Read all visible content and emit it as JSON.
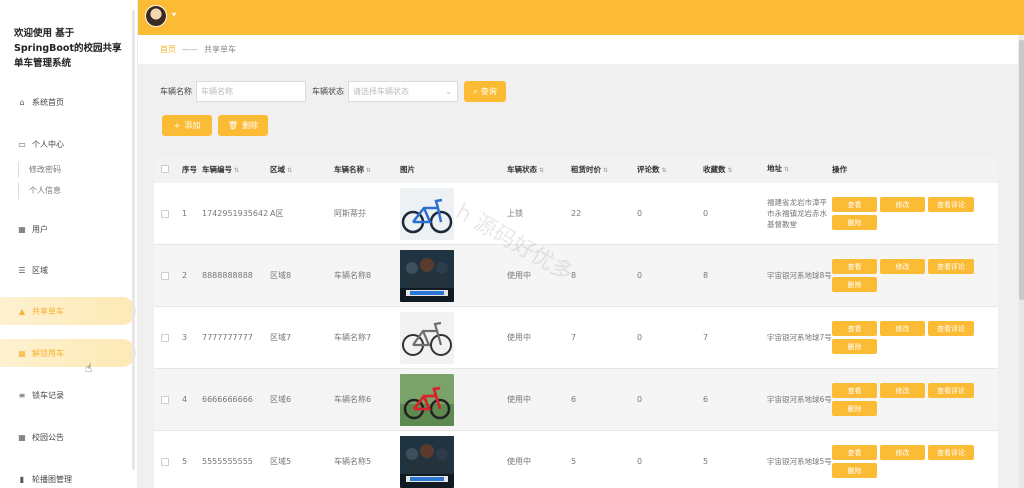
{
  "app": {
    "title": "欢迎使用 基于SpringBoot的校园共享单车管理系统"
  },
  "sidebar": {
    "items": [
      {
        "label": "系统首页",
        "icon": "home-icon"
      },
      {
        "label": "个人中心",
        "icon": "user-card-icon"
      },
      {
        "label": "用户",
        "icon": "grid-icon"
      },
      {
        "label": "区域",
        "icon": "sliders-icon"
      },
      {
        "label": "共享单车",
        "icon": "thumb-icon",
        "active": true
      },
      {
        "label": "解锁用车",
        "icon": "grid-icon",
        "hover": true
      },
      {
        "label": "锁车记录",
        "icon": "list-icon"
      },
      {
        "label": "校园公告",
        "icon": "grid-icon"
      },
      {
        "label": "轮播图管理",
        "icon": "bar-icon"
      }
    ],
    "subitems": [
      "修改密码",
      "个人信息"
    ]
  },
  "breadcrumb": {
    "home": "首页",
    "separator": "——",
    "current": "共享单车"
  },
  "search": {
    "name_label": "车辆名称",
    "name_placeholder": "车辆名称",
    "status_label": "车辆状态",
    "status_placeholder": "请选择车辆状态",
    "query_button": "查询"
  },
  "toolbar": {
    "add_label": "添加",
    "delete_label": "删除"
  },
  "table": {
    "headers": {
      "no": "序号",
      "code": "车辆编号",
      "area": "区域",
      "name": "车辆名称",
      "image": "图片",
      "status": "车辆状态",
      "price": "租赁时价",
      "comments": "评论数",
      "favorites": "收藏数",
      "address": "地址",
      "ops": "操作"
    },
    "op_labels": {
      "view": "查看",
      "edit": "修改",
      "review": "查看评论",
      "delete": "删除"
    },
    "rows": [
      {
        "no": "1",
        "code": "1742951935642",
        "area": "A区",
        "name": "阿斯蒂芬",
        "image": "blue-bike",
        "status": "上锁",
        "price": "22",
        "comments": "0",
        "favorites": "0",
        "address": "福建省龙岩市漳平市永福镇龙岩赤水基督教堂"
      },
      {
        "no": "2",
        "code": "8888888888",
        "area": "区域8",
        "name": "车辆名称8",
        "image": "movie-poster",
        "status": "使用中",
        "price": "8",
        "comments": "0",
        "favorites": "8",
        "address": "宇宙银河系地球8号"
      },
      {
        "no": "3",
        "code": "7777777777",
        "area": "区域7",
        "name": "车辆名称7",
        "image": "gray-bike",
        "status": "使用中",
        "price": "7",
        "comments": "0",
        "favorites": "7",
        "address": "宇宙银河系地球7号"
      },
      {
        "no": "4",
        "code": "6666666666",
        "area": "区域6",
        "name": "车辆名称6",
        "image": "red-bike",
        "status": "使用中",
        "price": "6",
        "comments": "0",
        "favorites": "6",
        "address": "宇宙银河系地球6号"
      },
      {
        "no": "5",
        "code": "5555555555",
        "area": "区域5",
        "name": "车辆名称5",
        "image": "movie-poster",
        "status": "使用中",
        "price": "5",
        "comments": "0",
        "favorites": "5",
        "address": "宇宙银河系地球5号"
      }
    ]
  },
  "watermark": "h 源码好优多",
  "colors": {
    "accent": "#fbbb34",
    "active_bg": "#fde9b5"
  }
}
